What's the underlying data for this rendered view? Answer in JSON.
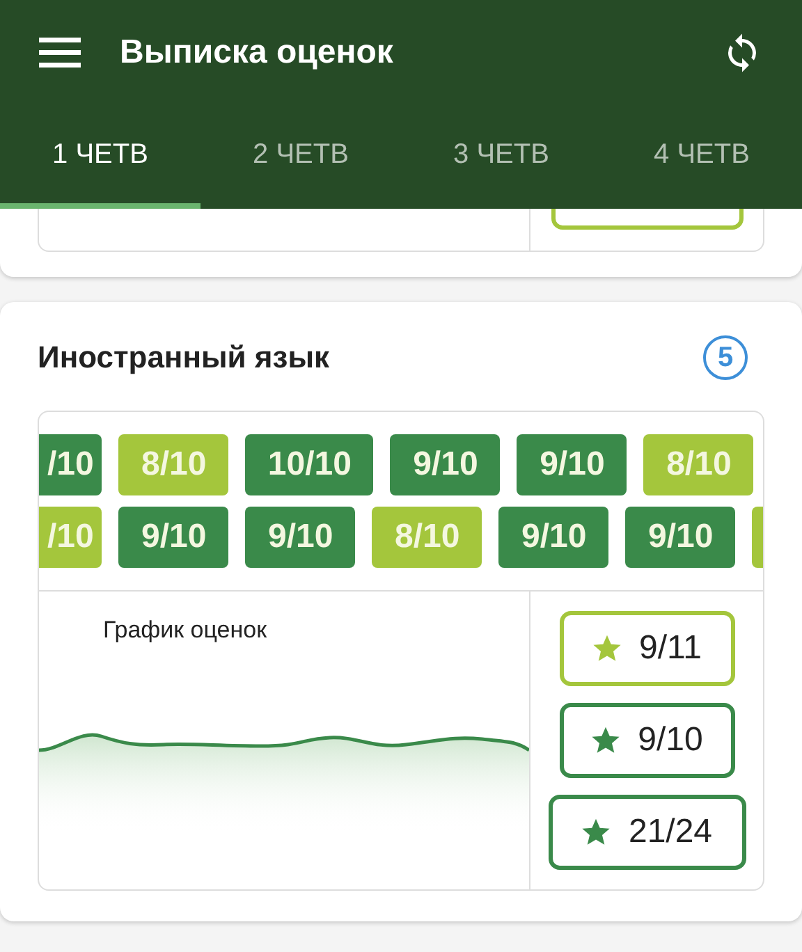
{
  "app_bar": {
    "title": "Выписка оценок"
  },
  "tabs": [
    {
      "label": "1 ЧЕТВ",
      "selected": true
    },
    {
      "label": "2 ЧЕТВ",
      "selected": false
    },
    {
      "label": "3 ЧЕТВ",
      "selected": false
    },
    {
      "label": "4 ЧЕТВ",
      "selected": false
    }
  ],
  "previous_subject": {
    "score_box": {
      "color": "#a4c63c"
    }
  },
  "subject": {
    "name": "Иностранный язык",
    "count": "5",
    "grade_rows": [
      [
        {
          "text": "/10",
          "color": "#3a8a4a"
        },
        {
          "text": "8/10",
          "color": "#a4c63c"
        },
        {
          "text": "10/10",
          "color": "#3a8a4a"
        },
        {
          "text": "9/10",
          "color": "#3a8a4a"
        },
        {
          "text": "9/10",
          "color": "#3a8a4a"
        },
        {
          "text": "8/10",
          "color": "#a4c63c"
        }
      ],
      [
        {
          "text": "/10",
          "color": "#a4c63c"
        },
        {
          "text": "9/10",
          "color": "#3a8a4a"
        },
        {
          "text": "9/10",
          "color": "#3a8a4a"
        },
        {
          "text": "8/10",
          "color": "#a4c63c"
        },
        {
          "text": "9/10",
          "color": "#3a8a4a"
        },
        {
          "text": "9/10",
          "color": "#3a8a4a"
        },
        {
          "color": "#a4c63c"
        }
      ]
    ],
    "chart_label": "График оценок",
    "scores": [
      {
        "text": "9/11",
        "color": "#a4c63c"
      },
      {
        "text": "9/10",
        "color": "#3a8a4a"
      },
      {
        "text": "21/24",
        "color": "#3a8a4a"
      }
    ]
  }
}
